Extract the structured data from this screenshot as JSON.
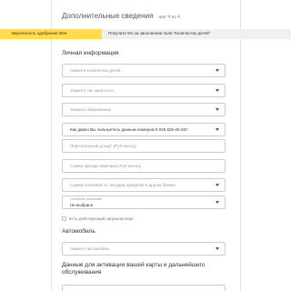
{
  "header": {
    "title": "Дополнительные сведения",
    "step": "шаг 4 из 4"
  },
  "progress": {
    "approval_label": "Вероятность одобрения 35%",
    "approval_percent": 35,
    "hint": "Получите 5% за заполнение поля \"Количество детей\"",
    "colors": {
      "fill": "#ffdb4d",
      "track": "#f0f0f0"
    }
  },
  "personal": {
    "title": "Личная информация",
    "children_placeholder": "Укажите количество детей",
    "employment_placeholder": "Укажите тип занятости",
    "education_placeholder": "Укажите образование",
    "contact_value": "Как давно Вы пользуетесь данным номером 8 926 825-26-28?",
    "income_placeholder": "Персональный доход* (Руб месяц)",
    "costs_placeholder": "Сумма аренды квартиры (Руб месяц)",
    "payments_placeholder": "Сумма платежей по текущим кредитам в других банках",
    "marital_label": "Семейное положение",
    "marital_value": "Не выбрано",
    "passport_checkbox": "Есть действующий загранпаспорт"
  },
  "car": {
    "title": "Автомобиль",
    "car_placeholder": "Укажите автомобиль"
  },
  "card": {
    "title": "Данные для активации вашей карты и дальнейшего обслуживания"
  }
}
